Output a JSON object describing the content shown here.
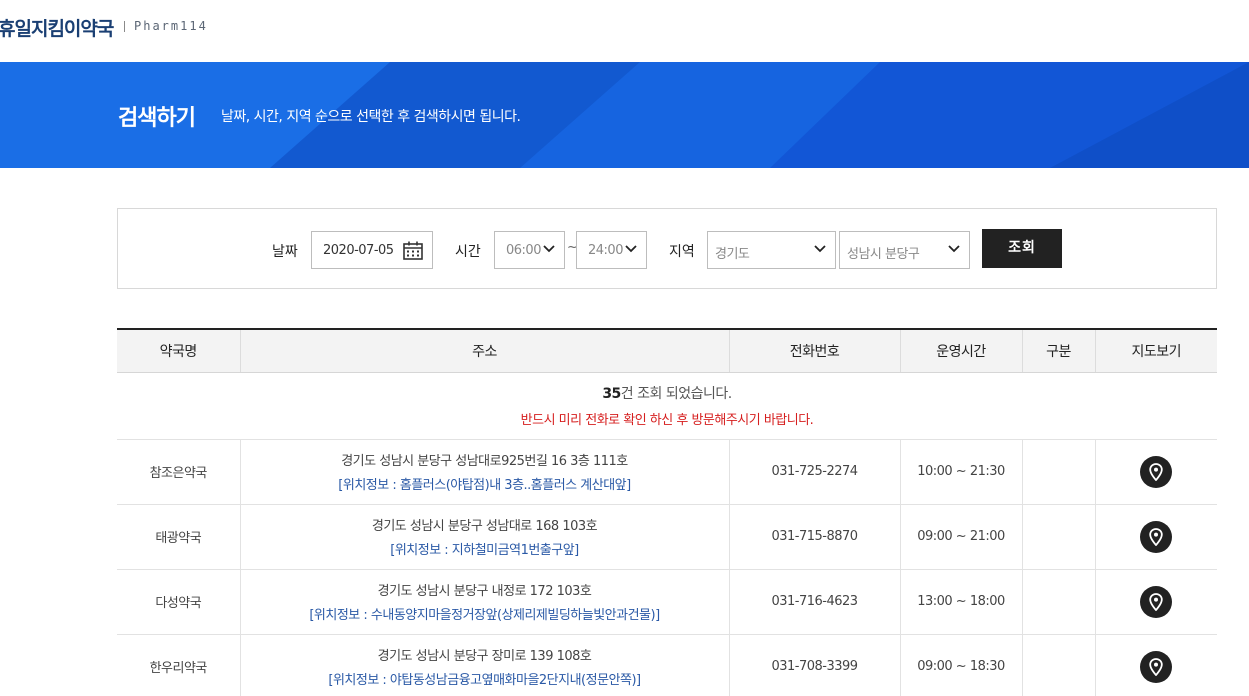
{
  "header": {
    "logo": "휴일지킴이약국",
    "logo_sub": "Pharm114"
  },
  "banner": {
    "title": "검색하기",
    "description": "날짜, 시간, 지역 순으로 선택한 후 검색하시면 됩니다."
  },
  "search": {
    "date_label": "날짜",
    "date_value": "2020-07-05",
    "time_label": "시간",
    "time_from": "06:00",
    "time_sep": "~",
    "time_to": "24:00",
    "region_label": "지역",
    "region_province": "경기도",
    "region_city": "성남시 분당구",
    "search_button": "조회"
  },
  "table": {
    "headers": [
      "약국명",
      "주소",
      "전화번호",
      "운영시간",
      "구분",
      "지도보기"
    ],
    "result_count": "35",
    "result_count_suffix": "건 조회 되었습니다.",
    "warning": "반드시 미리 전화로 확인 하신 후 방문해주시기 바랍니다.",
    "rows": [
      {
        "name": "참조은약국",
        "address": "경기도 성남시 분당구 성남대로925번길 16 3층 111호",
        "location": "[위치정보 : 홈플러스(야탑점)내 3층..홈플러스 계산대앞]",
        "phone": "031-725-2274",
        "hours": "10:00 ~ 21:30",
        "category": ""
      },
      {
        "name": "태광약국",
        "address": "경기도 성남시 분당구 성남대로 168 103호",
        "location": "[위치정보 : 지하철미금역1번출구앞]",
        "phone": "031-715-8870",
        "hours": "09:00 ~ 21:00",
        "category": ""
      },
      {
        "name": "다성약국",
        "address": "경기도 성남시 분당구 내정로 172 103호",
        "location": "[위치정보 : 수내동양지마을정거장앞(상제리제빌딩하늘빛안과건물)]",
        "phone": "031-716-4623",
        "hours": "13:00 ~ 18:00",
        "category": ""
      },
      {
        "name": "한우리약국",
        "address": "경기도 성남시 분당구 장미로 139 108호",
        "location": "[위치정보 : 야탑동성남금융고옆매화마을2단지내(정문안쪽)]",
        "phone": "031-708-3399",
        "hours": "09:00 ~ 18:30",
        "category": ""
      }
    ]
  },
  "colors": {
    "banner": "#1664e0",
    "button": "#222222",
    "warning": "#d61f1f",
    "location_text": "#2a59a6"
  }
}
